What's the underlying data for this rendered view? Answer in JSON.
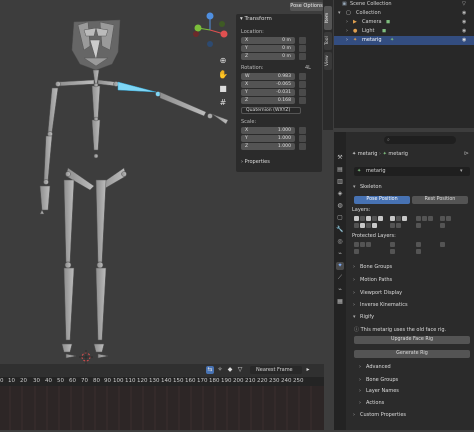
{
  "header": {
    "mode_button": "Pose Options"
  },
  "npanel": {
    "title": "Transform",
    "location_label": "Location:",
    "location": [
      {
        "axis": "X",
        "value": "0 m"
      },
      {
        "axis": "Y",
        "value": "0 m"
      },
      {
        "axis": "Z",
        "value": "0 m"
      }
    ],
    "rotation_label": "Rotation:",
    "rotation_mode_label": "4L",
    "rotation": [
      {
        "axis": "W",
        "value": "0.983"
      },
      {
        "axis": "X",
        "value": "-0.065"
      },
      {
        "axis": "Y",
        "value": "-0.031"
      },
      {
        "axis": "Z",
        "value": "0.168"
      }
    ],
    "rotation_mode": "Quaternion (WXYZ)",
    "scale_label": "Scale:",
    "scale": [
      {
        "axis": "X",
        "value": "1.000"
      },
      {
        "axis": "Y",
        "value": "1.000"
      },
      {
        "axis": "Z",
        "value": "1.000"
      }
    ],
    "properties_label": "Properties"
  },
  "vtabs": [
    "Item",
    "Tool",
    "View"
  ],
  "outliner": {
    "rows": [
      {
        "label": "Scene Collection",
        "indent": 0,
        "selected": false
      },
      {
        "label": "Collection",
        "indent": 1,
        "selected": false
      },
      {
        "label": "Camera",
        "indent": 2,
        "selected": false
      },
      {
        "label": "Light",
        "indent": 2,
        "selected": false
      },
      {
        "label": "metarig",
        "indent": 2,
        "selected": true
      }
    ]
  },
  "properties": {
    "breadcrumb_object": "metarig",
    "breadcrumb_data": "metarig",
    "data_name": "metarig",
    "skeleton_title": "Skeleton",
    "pose_position": "Pose Position",
    "rest_position": "Rest Position",
    "layers_label": "Layers:",
    "protected_layers_label": "Protected Layers:",
    "panels": [
      "Bone Groups",
      "Motion Paths",
      "Viewport Display",
      "Inverse Kinematics"
    ],
    "rigify_title": "Rigify",
    "rigify_warning": "This metarig uses the old face rig.",
    "upgrade_button": "Upgrade Face Rig",
    "generate_button": "Generate Rig",
    "subpanels": [
      "Advanced",
      "Bone Groups",
      "Layer Names",
      "Actions"
    ],
    "custom_properties": "Custom Properties"
  },
  "timeline": {
    "keying_label": "Nearest Frame",
    "frame_numbers": [
      "0",
      "10",
      "20",
      "30",
      "40",
      "50",
      "60",
      "70",
      "80",
      "90",
      "100",
      "110",
      "120",
      "130",
      "140",
      "150",
      "160",
      "170",
      "180",
      "190",
      "200",
      "210",
      "220",
      "230",
      "240",
      "250"
    ]
  },
  "colors": {
    "selection": "#334d80",
    "accent": "#4772b3",
    "bone": "#a9a9a9",
    "bone_selected": "#7fd6f5"
  }
}
